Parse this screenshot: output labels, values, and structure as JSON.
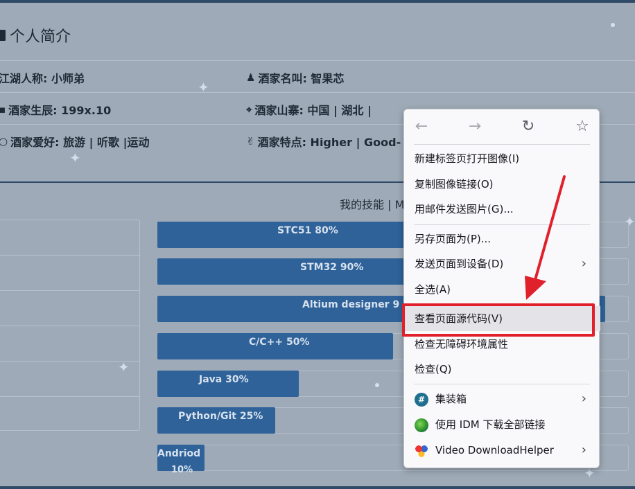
{
  "profile": {
    "title": "个人简介",
    "items": [
      {
        "label": "江湖人称: 小师弟"
      },
      {
        "label": "酒家名叫: 智果芯"
      },
      {
        "label": "酒家生辰: 199x.10"
      },
      {
        "label": "酒家山寨: 中国 | 湖北 |"
      },
      {
        "label": "酒家爱好: 旅游 | 听歌 |运动"
      },
      {
        "label": "酒家特点: Higher | Good-"
      }
    ]
  },
  "skills": {
    "heading": "我的技能 | M",
    "bars": [
      {
        "label": "STC51      80%",
        "percent": 80
      },
      {
        "label": "STM32      90%",
        "percent": 90
      },
      {
        "label": "Altium designer      9",
        "percent": 95
      },
      {
        "label": "C/C++ 50%",
        "percent": 50
      },
      {
        "label": "Java      30%",
        "percent": 30
      },
      {
        "label": "Python/Git  25%",
        "percent": 25
      },
      {
        "label": "Andriod",
        "label2": "10%",
        "percent": 10
      }
    ]
  },
  "context_menu": {
    "nav": {
      "back": "←",
      "forward": "→",
      "reload": "↻",
      "bookmark": "☆"
    },
    "group1": [
      "新建标签页打开图像(I)",
      "复制图像链接(O)",
      "用邮件发送图片(G)..."
    ],
    "group2": [
      "另存页面为(P)...",
      "发送页面到设备(D)",
      "全选(A)",
      "查看页面源代码(V)",
      "检查无障碍环境属性",
      "检查(Q)"
    ],
    "group3": [
      "集装箱",
      "使用 IDM 下载全部链接",
      "Video DownloadHelper"
    ],
    "highlight_color": "#e0202a"
  },
  "colors": {
    "page_bg": "#9eaab7",
    "bar": "#2e6299",
    "accent_red": "#e0202a"
  }
}
